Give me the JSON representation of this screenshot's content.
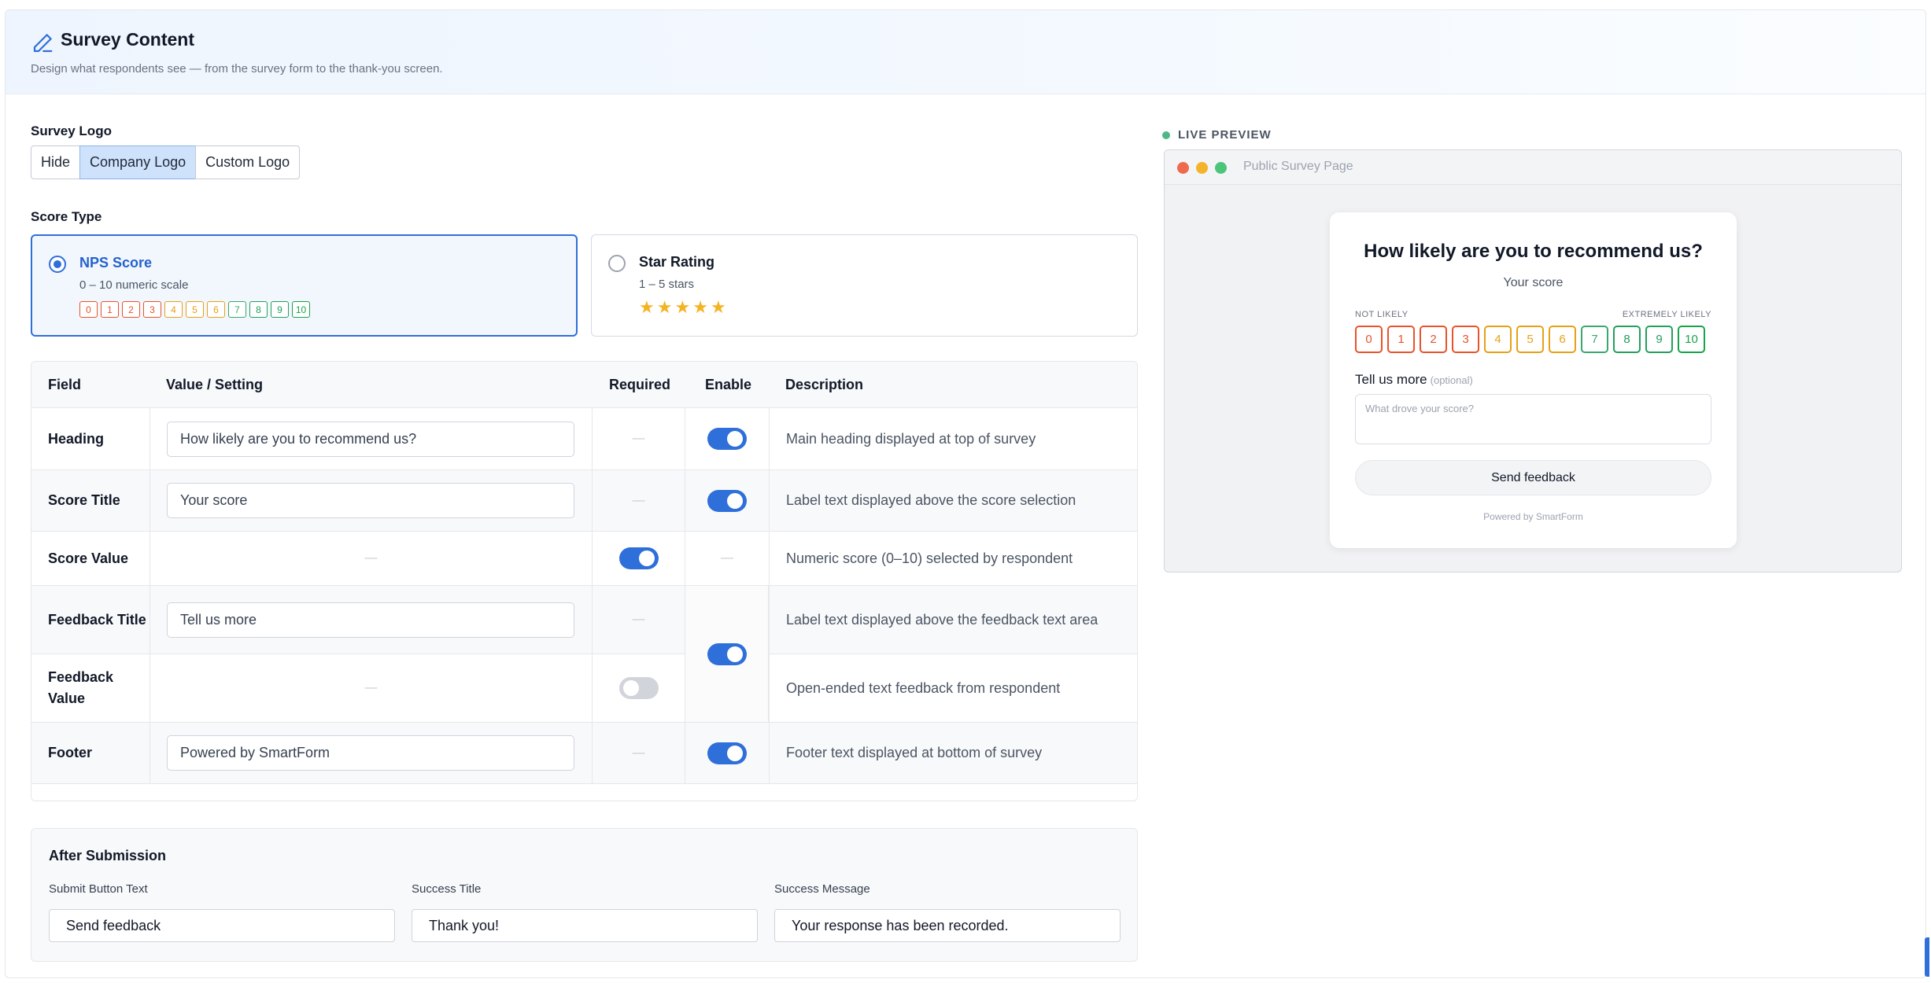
{
  "header": {
    "title": "Survey Content",
    "subtitle": "Design what respondents see — from the survey form to the thank-you screen.",
    "icon": "pencil-icon"
  },
  "survey_logo": {
    "label": "Survey Logo",
    "options": [
      "Hide",
      "Company Logo",
      "Custom Logo"
    ],
    "selected": "Company Logo"
  },
  "score_type": {
    "label": "Score Type",
    "nps": {
      "title": "NPS Score",
      "subtitle": "0 – 10 numeric scale",
      "selected": true,
      "scale": [
        "0",
        "1",
        "2",
        "3",
        "4",
        "5",
        "6",
        "7",
        "8",
        "9",
        "10"
      ]
    },
    "star": {
      "title": "Star Rating",
      "subtitle": "1 – 5 stars",
      "selected": false,
      "stars": 5
    }
  },
  "table": {
    "headers": {
      "field": "Field",
      "value": "Value / Setting",
      "required": "Required",
      "enable": "Enable",
      "description": "Description"
    },
    "rows": [
      {
        "field": "Heading",
        "value": "How likely are you to recommend us?",
        "required": "—",
        "enabled": true,
        "description": "Main heading displayed at top of survey"
      },
      {
        "field": "Score Title",
        "value": "Your score",
        "required": "—",
        "enabled": true,
        "description": "Label text displayed above the score selection"
      },
      {
        "field": "Score Value",
        "value": "—",
        "required_on": true,
        "enable": "—",
        "description": "Numeric score (0–10) selected by respondent"
      },
      {
        "field": "Feedback Title",
        "value": "Tell us more",
        "required": "—",
        "description": "Label text displayed above the feedback text area"
      },
      {
        "field": "Feedback Value",
        "value": "—",
        "required_on": false,
        "description": "Open-ended text feedback from respondent"
      },
      {
        "field": "Footer",
        "value": "Powered by SmartForm",
        "required": "—",
        "enabled": true,
        "description": "Footer text displayed at bottom of survey"
      }
    ],
    "feedback_enabled": true
  },
  "after_submission": {
    "title": "After Submission",
    "submit_label": "Submit Button Text",
    "submit_value": "Send feedback",
    "success_title_label": "Success Title",
    "success_title_value": "Thank you!",
    "success_message_label": "Success Message",
    "success_message_value": "Your response has been recorded."
  },
  "preview": {
    "badge": "LIVE PREVIEW",
    "window_title": "Public Survey Page",
    "heading": "How likely are you to recommend us?",
    "score_title": "Your score",
    "low_label": "NOT LIKELY",
    "high_label": "EXTREMELY LIKELY",
    "scale": [
      "0",
      "1",
      "2",
      "3",
      "4",
      "5",
      "6",
      "7",
      "8",
      "9",
      "10"
    ],
    "feedback_title": "Tell us more",
    "optional": "(optional)",
    "feedback_placeholder": "What drove your score?",
    "button": "Send feedback",
    "footer": "Powered by SmartForm"
  },
  "colors": {
    "accent": "#2f6fd9",
    "scale": [
      "#e8532b",
      "#e8532b",
      "#e8532b",
      "#e8532b",
      "#e6a117",
      "#e6a117",
      "#e6a117",
      "#3aa76d",
      "#22a05c",
      "#22a05c",
      "#16a34a"
    ],
    "live_dot": "#4fb886",
    "traffic": [
      "#ef6a4c",
      "#f4b32a",
      "#4cc47a"
    ]
  }
}
